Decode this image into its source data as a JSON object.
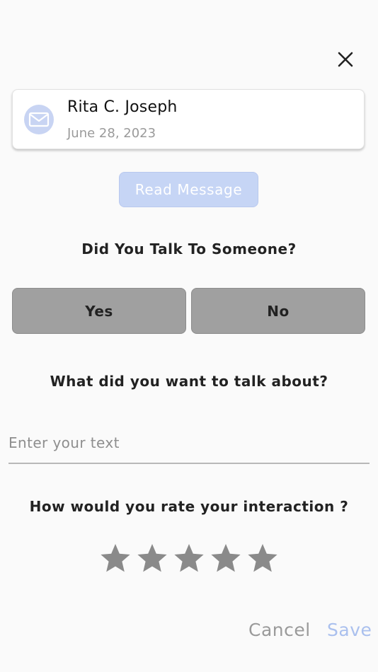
{
  "message_card": {
    "sender": "Rita C. Joseph",
    "date": "June 28, 2023",
    "icon": "mail-icon"
  },
  "read_message_label": "Read Message",
  "question1": "Did You Talk To Someone?",
  "choices": {
    "yes": "Yes",
    "no": "No"
  },
  "question2": "What did you want to talk about?",
  "topic_input": {
    "placeholder": "Enter your text",
    "value": ""
  },
  "question3": "How would you rate your interaction ?",
  "rating": {
    "max": 5,
    "value": 0
  },
  "footer": {
    "cancel": "Cancel",
    "save": "Save"
  },
  "colors": {
    "background": "#fafafa",
    "avatar_bg": "#c8d4f3",
    "read_button_bg": "#c6d5f5",
    "choice_button_bg": "#a0a0a0",
    "star": "#8a8a8a",
    "cancel": "#9a9a9a",
    "save": "#aac0ee"
  }
}
